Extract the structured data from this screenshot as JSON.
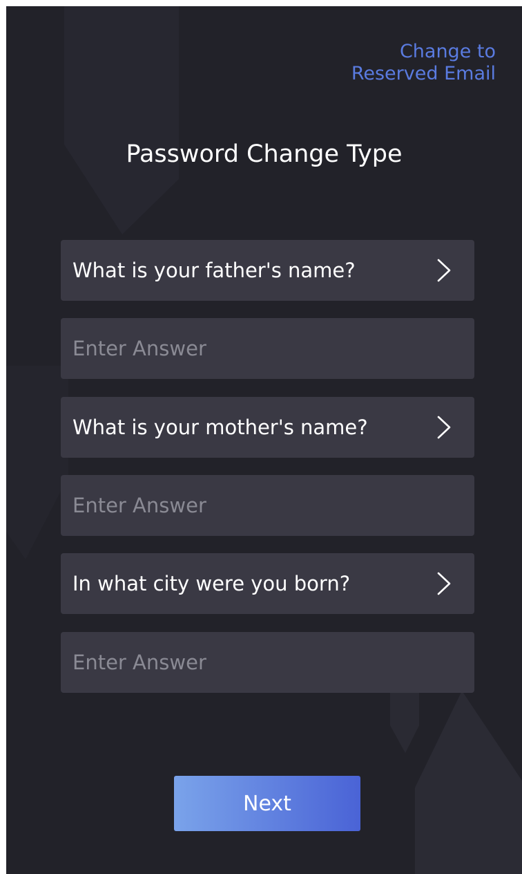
{
  "header": {
    "link_line1": "Change to",
    "link_line2": "Reserved Email",
    "link_color": "#5a7be0"
  },
  "title": "Password Change Type",
  "questions": [
    {
      "label": "What is your father's name?",
      "answer_placeholder": "Enter Answer",
      "answer_value": ""
    },
    {
      "label": "What is your mother's name?",
      "answer_placeholder": "Enter Answer",
      "answer_value": ""
    },
    {
      "label": "In what city were you born?",
      "answer_placeholder": "Enter Answer",
      "answer_value": ""
    }
  ],
  "icons": {
    "question_chevron": "chevron-right-icon"
  },
  "next_button": {
    "label": "Next"
  },
  "colors": {
    "background": "#222229",
    "field_background": "#3a3944",
    "button_gradient_start": "#7aa3ea",
    "button_gradient_end": "#4a63d6"
  }
}
